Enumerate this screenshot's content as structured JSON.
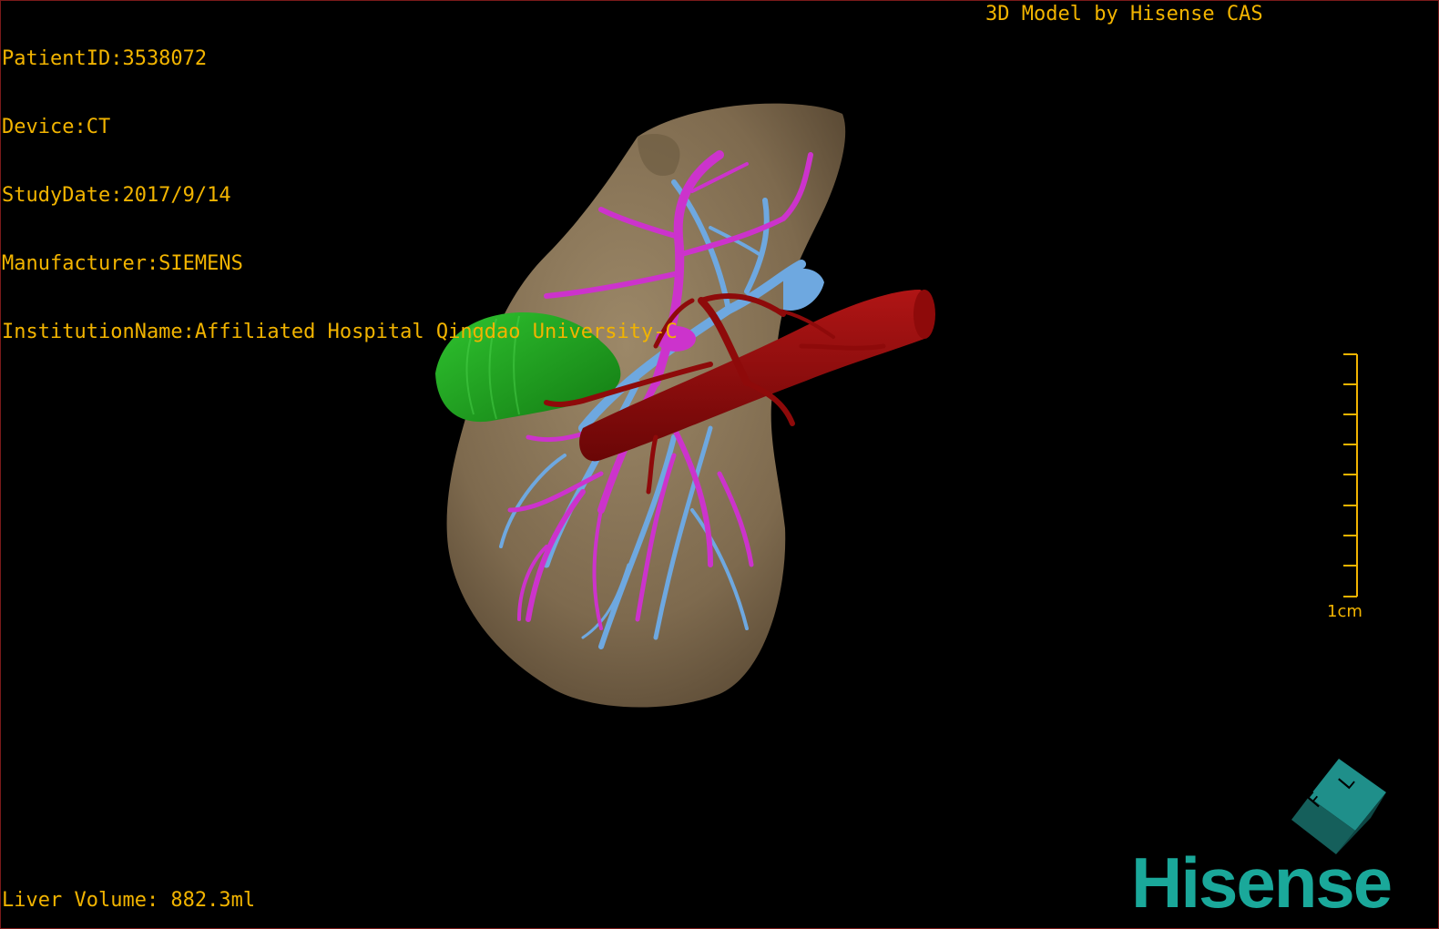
{
  "header": {
    "patient_id": "PatientID:3538072",
    "device": "Device:CT",
    "study_date": "StudyDate:2017/9/14",
    "manufacturer": "Manufacturer:SIEMENS",
    "institution": "InstitutionName:Affiliated Hospital Qingdao University-C"
  },
  "branding": {
    "model_credit": "3D Model by Hisense CAS",
    "logo_text": "Hisense"
  },
  "footer": {
    "liver_volume": "Liver Volume: 882.3ml"
  },
  "scale_bar": {
    "label": "1cm"
  },
  "orientation_cube": {
    "labels": [
      "F",
      "L"
    ]
  },
  "colors": {
    "overlay_text": "#f2b400",
    "liver": "#8a7456",
    "gallbladder": "#1fa31f",
    "portal_vein": "#cc33cc",
    "hepatic_vein": "#6ea8e0",
    "artery_ivc": "#8e0a0a",
    "logo": "#1aa89a"
  },
  "icons": {
    "orientation_cube": "orientation-cube-icon",
    "model": "liver-3d-model"
  }
}
